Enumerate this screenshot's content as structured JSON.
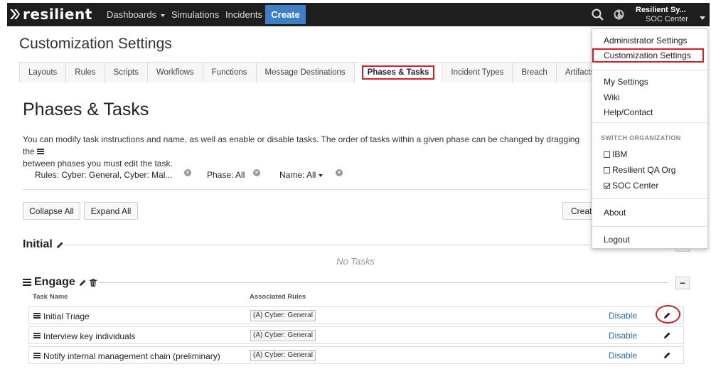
{
  "nav": {
    "logo": "resilient",
    "links": [
      "Dashboards",
      "Simulations",
      "Incidents"
    ],
    "create_label": "Create",
    "user_name": "Resilient Sy...",
    "user_org": "SOC Center"
  },
  "page": {
    "title": "Customization Settings",
    "tabs": [
      "Layouts",
      "Rules",
      "Scripts",
      "Workflows",
      "Functions",
      "Message Destinations",
      "Phases & Tasks",
      "Incident Types",
      "Breach",
      "Artifacts"
    ],
    "active_tab": "Phases & Tasks"
  },
  "section": {
    "title": "Phases & Tasks",
    "description_line1": "You can modify task instructions and name, as well as enable or disable tasks. The order of tasks within a given phase can be changed by dragging the",
    "description_line2": "between phases you must edit the task."
  },
  "filters": {
    "rules": "Rules: Cyber: General, Cyber: Mal...",
    "phase": "Phase: All",
    "name": "Name: All"
  },
  "buttons": {
    "collapse_all": "Collapse All",
    "expand_all": "Expand All",
    "create": "Creat"
  },
  "phases": {
    "initial": {
      "name": "Initial",
      "empty_text": "No Tasks"
    },
    "engage": {
      "name": "Engage"
    }
  },
  "table": {
    "col_task_name": "Task Name",
    "col_rules": "Associated Rules",
    "rows": [
      {
        "name": "Initial Triage",
        "rule": "(A) Cyber: General",
        "action": "Disable"
      },
      {
        "name": "Interview key individuals",
        "rule": "(A) Cyber: General",
        "action": "Disable"
      },
      {
        "name": "Notify internal management chain (preliminary)",
        "rule": "(A) Cyber: General",
        "action": "Disable"
      }
    ]
  },
  "dropdown": {
    "admin_settings": "Administrator Settings",
    "customization_settings": "Customization Settings",
    "my_settings": "My Settings",
    "wiki": "Wiki",
    "help": "Help/Contact",
    "switch_org_header": "SWITCH ORGANIZATION",
    "orgs": [
      {
        "name": "IBM",
        "checked": false
      },
      {
        "name": "Resilient QA Org",
        "checked": false
      },
      {
        "name": "SOC Center",
        "checked": true
      }
    ],
    "about": "About",
    "logout": "Logout"
  },
  "colors": {
    "nav_bg": "#1e1e1e",
    "create_button": "#3f7fc7",
    "highlight": "#d0202a",
    "link": "#2a6bb5"
  }
}
